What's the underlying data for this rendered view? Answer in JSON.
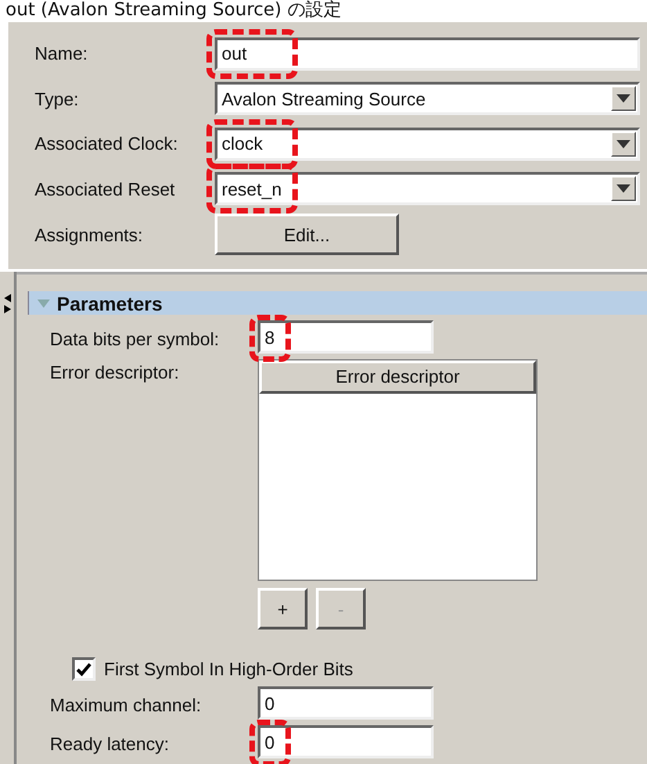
{
  "caption": "out (Avalon Streaming Source) の設定",
  "interface": [
    {
      "kind": "text",
      "label": "Name:",
      "value": "out",
      "highlighted": true
    },
    {
      "kind": "dropdown",
      "label": "Type:",
      "value": "Avalon Streaming Source"
    },
    {
      "kind": "dropdown",
      "label": "Associated Clock:",
      "value": "clock",
      "highlighted": true
    },
    {
      "kind": "dropdown",
      "label": "Associated Reset",
      "value": "reset_n",
      "highlighted": true
    },
    {
      "kind": "button",
      "label": "Assignments:",
      "value": "Edit..."
    }
  ],
  "parameters": {
    "title": "Parameters",
    "expanded": true,
    "data_bits": {
      "label": "Data bits per symbol:",
      "value": "8",
      "highlighted": true
    },
    "error_descriptor": {
      "label": "Error descriptor:",
      "column": "Error descriptor",
      "add": "+",
      "remove": "-",
      "remove_disabled": true
    },
    "first_symbol": {
      "label": "First Symbol In High-Order Bits",
      "checked": true
    },
    "max_channel": {
      "label": "Maximum channel:",
      "value": "0"
    },
    "ready_latency": {
      "label": "Ready latency:",
      "value": "0",
      "highlighted": true
    }
  }
}
